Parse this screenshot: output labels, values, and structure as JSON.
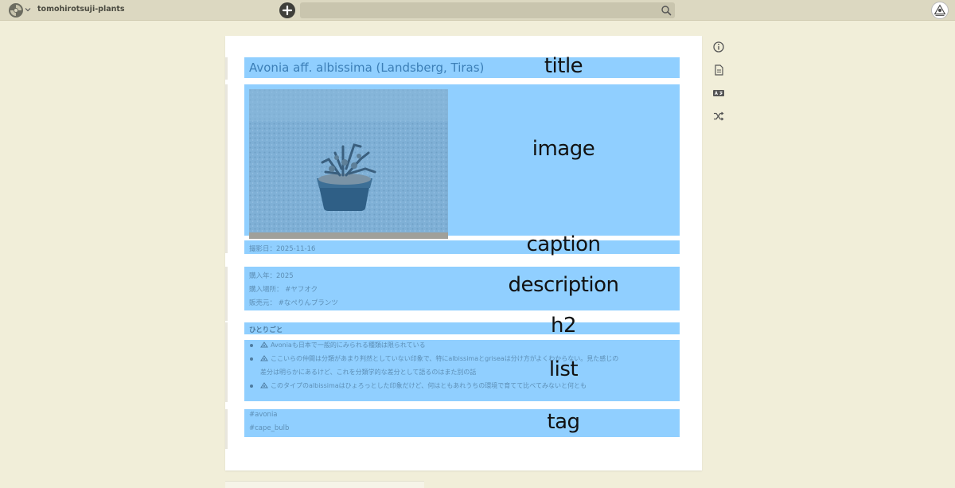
{
  "header": {
    "project_name": "tomohirotsuji-plants",
    "search": {
      "value": "",
      "placeholder": ""
    }
  },
  "page": {
    "title": "Avonia aff. albissima (Landsberg, Tiras)",
    "caption": "撮影日：2025-11-16",
    "description": {
      "year_label": "購入年：2025",
      "place_label": "購入場所：",
      "place_tag": "#ヤフオク",
      "seller_label": "販売元：",
      "seller_tag": "#なぺりんプランツ"
    },
    "h2": "ひとりごと",
    "list": [
      "Avoniaも日本で一般的にみられる種類は限られている",
      "ここいらの仲間は分類があまり判然としていない印象で、特にalbissimaとgriseaは分け方がよくわからない。見た感じの",
      "差分は明らかにあるけど、これを分類学的な差分として語るのはまた別の話",
      "このタイプのalbissimaはひょろっとした印象だけど、何はともあれうちの環境で育てて比べてみないと何とも"
    ],
    "tags": [
      "#avonia",
      "#cape_bulb"
    ]
  },
  "annotations": {
    "title": "title",
    "image": "image",
    "caption": "caption",
    "description": "description",
    "h2": "h2",
    "list": "list",
    "tag": "tag"
  },
  "colors": {
    "highlight": "#90cfff",
    "background": "#f1eed9",
    "topbar": "#dcd8c1",
    "link": "#3c7fb7"
  },
  "icons": {
    "side_toolbar": [
      "info-icon",
      "document-icon",
      "translate-icon",
      "shuffle-icon"
    ]
  }
}
